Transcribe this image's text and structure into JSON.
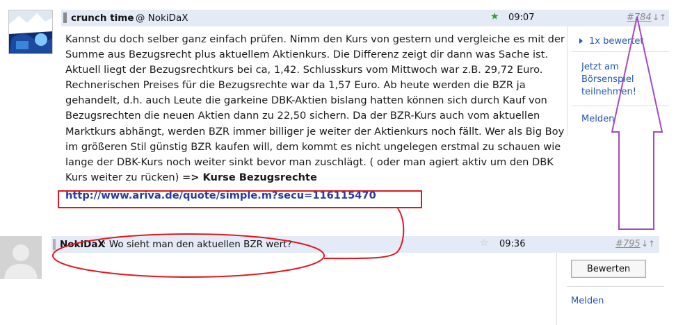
{
  "colors": {
    "header_bg": "#e4ebf6",
    "link": "#2356b0",
    "url": "#2a3a9c",
    "annotation_red": "#e0161e",
    "annotation_purple": "#a24bc0",
    "star_active": "#2aa52a",
    "star_inactive": "#bbbbbb"
  },
  "post1": {
    "author": "crunch time",
    "reply_to": ": @ NokiDaX",
    "star_icon": "star-filled-icon",
    "time": "09:07",
    "post_number": "#784",
    "sort_icon": "↓↑",
    "body": "Kannst du doch selber ganz einfach prüfen. Nimm den Kurs von gestern und vergleiche es mit der Summe aus Bezugsrecht plus aktuellem Aktienkurs. Die Differenz zeigt dir dann was Sache ist. Aktuell liegt der Bezugsrechtkurs bei ca, 1,42. Schlusskurs vom Mittwoch war z.B. 29,72 Euro. Rechnerischen Preises für die Bezugsrechte war da 1,57 Euro. Ab heute werden die BZR ja gehandelt, d.h. auch Leute die garkeine DBK-Aktien bislang hatten können sich durch Kauf von Bezugsrechten die neuen Aktien dann zu 22,50 sichern. Da der BZR-Kurs auch vom aktuellen Marktkurs abhängt, werden BZR immer billiger je weiter der Aktienkurs noch fällt. Wer als Big Boy im größeren Stil günstig BZR kaufen will, dem kommt es nicht ungelegen erstmal zu schauen wie lange der DBK-Kurs noch weiter sinkt bevor man zuschlägt. ( oder man agiert aktiv um den DBK Kurs weiter zu rücken) ",
    "inline_link": "=> Kurse Bezugsrechte",
    "url": "http://www.ariva.de/quote/simple.m?secu=116115470",
    "sidebar": {
      "rated": "1x bewertet",
      "join_line1": "Jetzt am",
      "join_line2": "Börsenspiel",
      "join_line3": "teilnehmen!",
      "report": "Melden"
    }
  },
  "post2": {
    "author": "NokiDaX",
    "text": ": Wo sieht man den aktuellen BZR wert?",
    "star_icon": "star-outline-icon",
    "time": "09:36",
    "post_number": "#795",
    "sort_icon": "↓↑",
    "sidebar": {
      "rate_button": "Bewerten",
      "report": "Melden"
    }
  }
}
